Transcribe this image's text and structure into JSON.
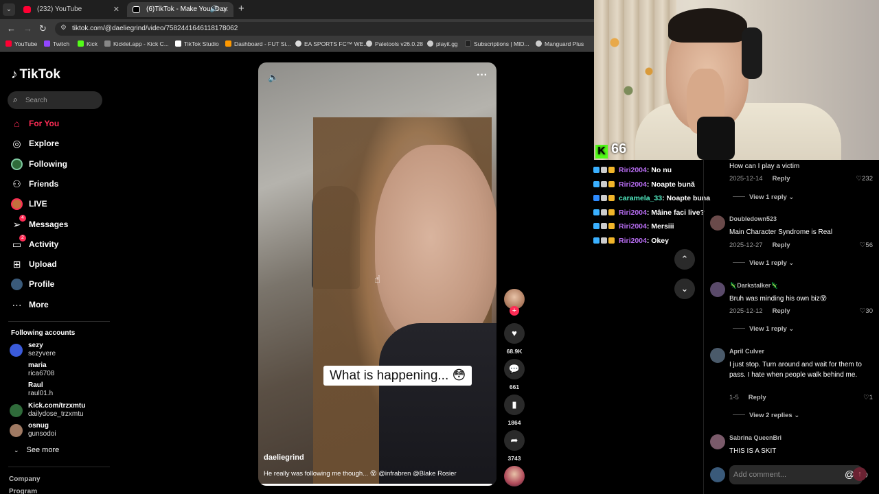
{
  "browser": {
    "tabs": [
      {
        "title": "(232) YouTube",
        "favicon_color": "#ff0033"
      },
      {
        "title": "(6)TikTok - Make Your Day",
        "favicon_color": "#ffffff"
      }
    ],
    "url": "tiktok.com/@daeliegrind/video/7582441646118178062",
    "bookmarks": [
      {
        "label": "YouTube",
        "color": "#ff0033"
      },
      {
        "label": "Twitch",
        "color": "#9146ff"
      },
      {
        "label": "Kick",
        "color": "#53fc18"
      },
      {
        "label": "Kicklet.app - Kick C...",
        "color": "#888888"
      },
      {
        "label": "TikTok Studio",
        "color": "#ffffff"
      },
      {
        "label": "Dashboard - FUT Si...",
        "color": "#ff9900"
      },
      {
        "label": "EA SPORTS FC™ WE...",
        "color": "#dddddd"
      },
      {
        "label": "Paletools v26.0.28",
        "color": "#cccccc"
      },
      {
        "label": "playit.gg",
        "color": "#cccccc"
      },
      {
        "label": "Subscriptions | MID...",
        "color": "#222222"
      },
      {
        "label": "Manguard Plus",
        "color": "#cccccc"
      }
    ]
  },
  "tiktok": {
    "logo": "TikTok",
    "search_placeholder": "Search",
    "nav": [
      {
        "label": "For You",
        "icon": "home-icon"
      },
      {
        "label": "Explore",
        "icon": "compass-icon"
      },
      {
        "label": "Following",
        "icon": "following-icon"
      },
      {
        "label": "Friends",
        "icon": "friends-icon"
      },
      {
        "label": "LIVE",
        "icon": "live-icon"
      },
      {
        "label": "Messages",
        "icon": "messages-icon",
        "badge": "4"
      },
      {
        "label": "Activity",
        "icon": "activity-icon",
        "badge": "2"
      },
      {
        "label": "Upload",
        "icon": "upload-icon"
      },
      {
        "label": "Profile",
        "icon": "profile-icon"
      },
      {
        "label": "More",
        "icon": "more-icon"
      }
    ],
    "following_title": "Following accounts",
    "accounts": [
      {
        "name": "sezy",
        "handle": "sezyvere",
        "color": "#3b5bdb"
      },
      {
        "name": "maria",
        "handle": "rica6708",
        "color": "#000000"
      },
      {
        "name": "Raul",
        "handle": "raul01.h",
        "color": "#000000"
      },
      {
        "name": "Kick.com/trzxmtu",
        "handle": "dailydose_trzxmtu",
        "color": "#2f6b3a"
      },
      {
        "name": "osnug",
        "handle": "gunsodoi",
        "color": "#a07a63"
      }
    ],
    "see_more": "See more",
    "footer": [
      "Company",
      "Program"
    ]
  },
  "video": {
    "caption": "What is happening... 😳",
    "author": "daeliegrind",
    "description": "He really was following me though... 😵 @infrabren @Blake Rosier",
    "progress": 0.98
  },
  "actions": {
    "likes": "68.9K",
    "comments": "661",
    "saves": "1864",
    "shares": "3743"
  },
  "stream": {
    "kick_count": "66",
    "chat": [
      {
        "user": "Riri2004",
        "message": ": No nu",
        "alt": false
      },
      {
        "user": "Riri2004",
        "message": ": Noapte bună",
        "alt": false
      },
      {
        "user": "caramela_33",
        "message": ": Noapte buna",
        "alt": true
      },
      {
        "user": "Riri2004",
        "message": ": Mâine faci live?",
        "alt": false
      },
      {
        "user": "Riri2004",
        "message": ": Mersiii",
        "alt": false
      },
      {
        "user": "Riri2004",
        "message": ": Okey",
        "alt": false
      }
    ]
  },
  "comments": {
    "top": {
      "text": "How can I play a victim",
      "date": "2025-12-14",
      "likes": "232",
      "view_replies": "View 1 reply"
    },
    "items": [
      {
        "name": "Doubledown523",
        "text": "Main Character Syndrome is Real",
        "date": "2025-12-27",
        "likes": "56",
        "view_replies": "View 1 reply",
        "color": "#6a4a4a"
      },
      {
        "name": "🦎Darkstalker🦎",
        "text": "Bruh was minding his own biz😵",
        "date": "2025-12-12",
        "likes": "30",
        "view_replies": "View 1 reply",
        "color": "#5a4a6a"
      },
      {
        "name": "April Culver",
        "text": "I just stop. Turn around and wait for them to pass. I hate when people walk behind me.",
        "date": "1-5",
        "likes": "1",
        "view_replies": "View 2 replies",
        "color": "#4a5a6a"
      },
      {
        "name": "Sabrina QueenBri",
        "text": "THIS IS A SKIT",
        "color": "#7a5a6a"
      }
    ],
    "reply_label": "Reply",
    "input_placeholder": "Add comment..."
  }
}
